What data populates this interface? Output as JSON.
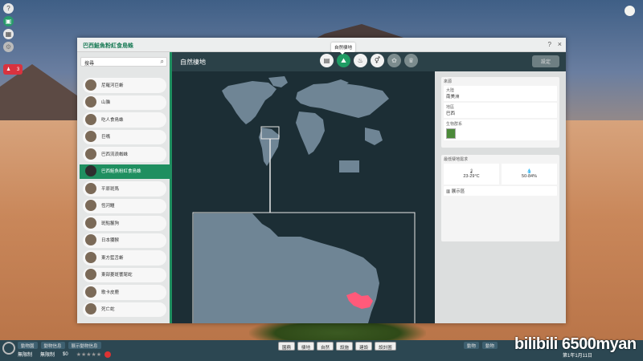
{
  "panel": {
    "title": "巴西鮭魚粉紅食鳥蛛",
    "help": "?",
    "close": "×"
  },
  "search": {
    "value": "搜尋"
  },
  "species": [
    {
      "name": "尼羅河巨蜥"
    },
    {
      "name": "山貓"
    },
    {
      "name": "吃人食鳥蛛"
    },
    {
      "name": "巨嘴"
    },
    {
      "name": "巴西流浪蜘蛛"
    },
    {
      "name": "巴西鮭魚粉紅食鳥蛛",
      "selected": true
    },
    {
      "name": "平原斑馬"
    },
    {
      "name": "恆河鱷"
    },
    {
      "name": "斑點鬣狗"
    },
    {
      "name": "日本獼猴"
    },
    {
      "name": "東方藍舌蜥"
    },
    {
      "name": "東部菱斑響尾蛇"
    },
    {
      "name": "歌卡皮鹿"
    },
    {
      "name": "死亡蛇"
    }
  ],
  "main": {
    "title": "自然棲地",
    "tooltip": "自然棲地",
    "action_btn": "設定"
  },
  "tabs": [
    {
      "icon": "document-icon"
    },
    {
      "icon": "habitat-icon",
      "active": true
    },
    {
      "icon": "food-icon"
    },
    {
      "icon": "adult-icon"
    },
    {
      "icon": "paw-icon"
    },
    {
      "icon": "trophy-icon"
    }
  ],
  "info": {
    "h1": "來源",
    "continent_label": "大陸",
    "continent": "南美洲",
    "region_label": "地區",
    "region": "巴西",
    "biome_label": "生物群系",
    "h2": "最低棲地需求",
    "temp": "23-29°C",
    "humidity": "50-84%",
    "exhibit": "展示區"
  },
  "bottom": {
    "b1": "動物園",
    "b2": "動物信息",
    "b3": "展示動物信息",
    "l1": "無限制",
    "l2": "無限制",
    "money": "$0",
    "c1": "園務",
    "c2": "棲地",
    "c3": "自然",
    "c4": "設施",
    "c5": "建設",
    "c6": "設計圖",
    "r1": "動物",
    "r2": "動物",
    "date": "第1年1月11日",
    "watermark": "bilibili 6500myan"
  },
  "colors": {
    "accent": "#1f8f60",
    "range": "#ff5a7a",
    "ocean": "#1c2e35",
    "land": "#6f8595"
  }
}
